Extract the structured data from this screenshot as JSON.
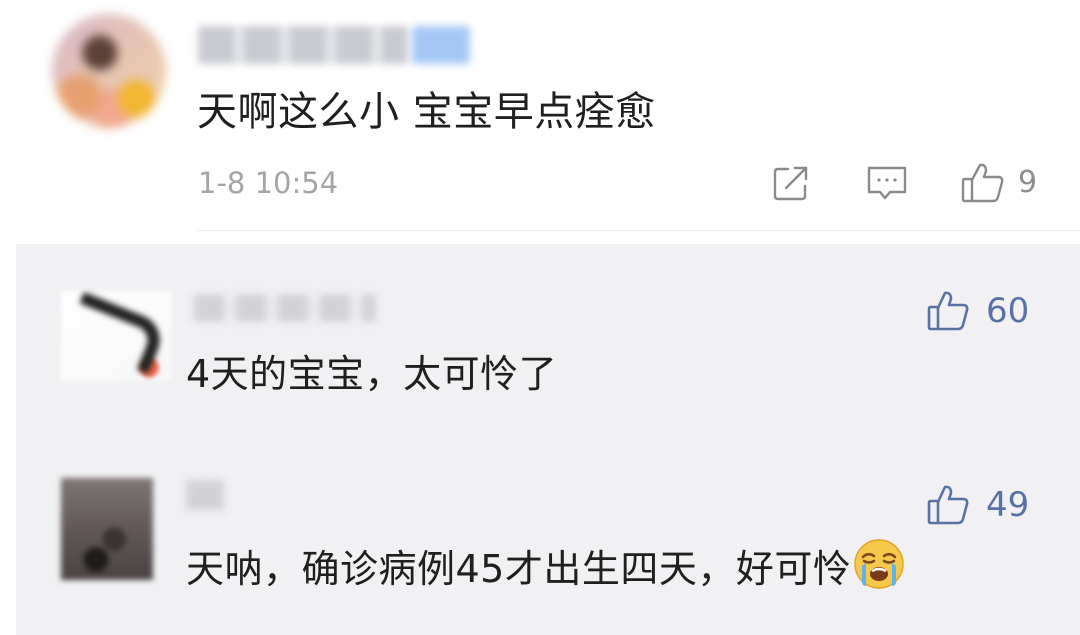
{
  "main_comment": {
    "text": "天啊这么小 宝宝早点痊愈",
    "timestamp": "1-8 10:54",
    "like_count": "9",
    "icons": {
      "share": "share-icon",
      "comment": "comment-icon",
      "like": "thumbs-up-icon"
    }
  },
  "replies": [
    {
      "text": "4天的宝宝，太可怜了",
      "like_count": "60"
    },
    {
      "text": "天呐，确诊病例45才出生四天，好可怜",
      "like_count": "49",
      "trailing_emoji": "crying-face-emoji"
    }
  ],
  "colors": {
    "body_text": "#1f1f1f",
    "timestamp": "#a5a5a5",
    "reply_like_accent": "#5a71a6",
    "reply_background": "#f1f1f3"
  }
}
